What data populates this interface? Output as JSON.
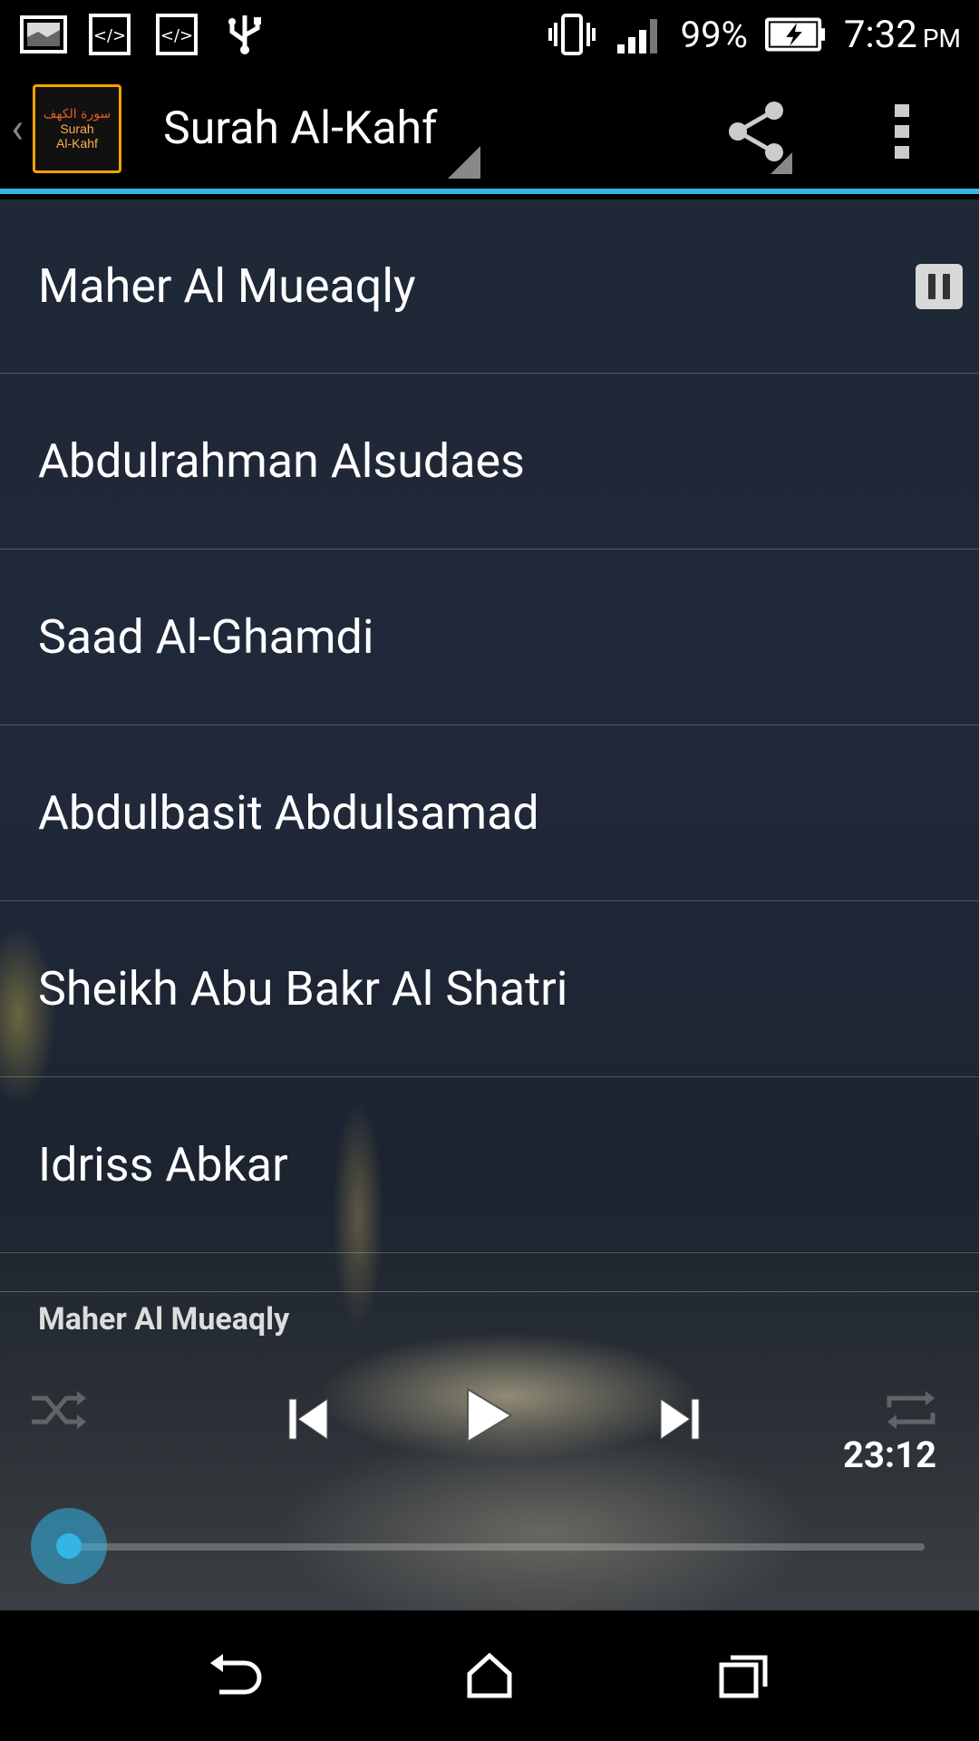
{
  "status_bar": {
    "icons": [
      "gallery-icon",
      "code-icon",
      "code-icon",
      "usb-icon"
    ],
    "battery_percent": "99%",
    "time": "7:32",
    "ampm": "PM"
  },
  "action_bar": {
    "logo_arabic": "سورة الكهف",
    "logo_line1": "Surah",
    "logo_line2": "Al-Kahf",
    "title": "Surah Al-Kahf"
  },
  "list": {
    "items": [
      {
        "name": "Maher Al Mueaqly",
        "playing": true
      },
      {
        "name": "Abdulrahman Alsudaes"
      },
      {
        "name": "Saad Al-Ghamdi"
      },
      {
        "name": "Abdulbasit Abdulsamad"
      },
      {
        "name": "Sheikh Abu Bakr Al Shatri"
      },
      {
        "name": "Idriss Abkar"
      }
    ]
  },
  "player": {
    "now_playing": "Maher Al Mueaqly",
    "duration": "23:12",
    "progress": 0.0
  },
  "colors": {
    "accent": "#33b5e5",
    "logo_border": "#f7a000"
  }
}
